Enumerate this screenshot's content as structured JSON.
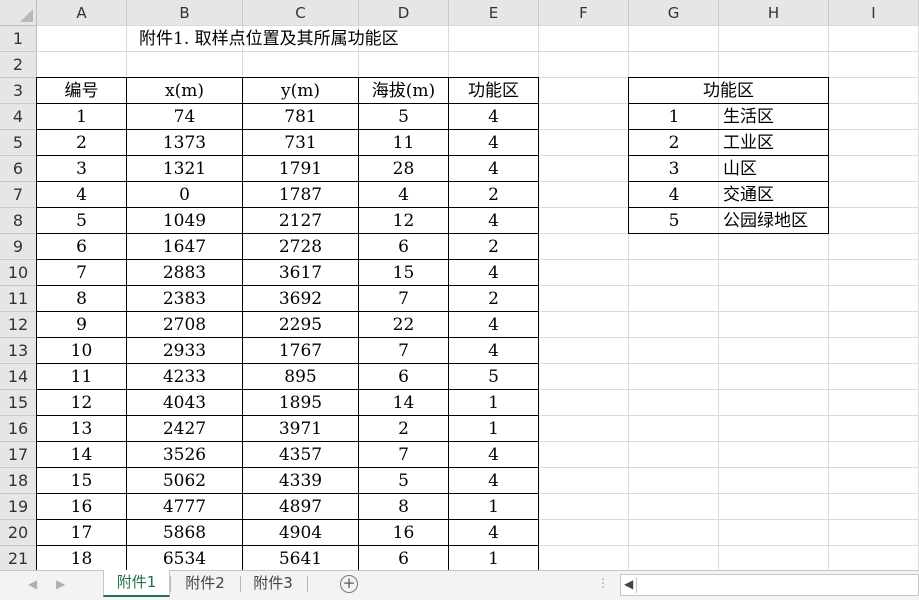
{
  "column_headers": [
    "A",
    "B",
    "C",
    "D",
    "E",
    "F",
    "G",
    "H",
    "I"
  ],
  "row_headers": [
    "1",
    "2",
    "3",
    "4",
    "5",
    "6",
    "7",
    "8",
    "9",
    "10",
    "11",
    "12",
    "13",
    "14",
    "15",
    "16",
    "17",
    "18",
    "19",
    "20",
    "21"
  ],
  "title": "附件1. 取样点位置及其所属功能区",
  "table_headers": [
    "编号",
    "x(m)",
    "y(m)",
    "海拔(m)",
    "功能区"
  ],
  "table_rows": [
    [
      "1",
      "74",
      "781",
      "5",
      "4"
    ],
    [
      "2",
      "1373",
      "731",
      "11",
      "4"
    ],
    [
      "3",
      "1321",
      "1791",
      "28",
      "4"
    ],
    [
      "4",
      "0",
      "1787",
      "4",
      "2"
    ],
    [
      "5",
      "1049",
      "2127",
      "12",
      "4"
    ],
    [
      "6",
      "1647",
      "2728",
      "6",
      "2"
    ],
    [
      "7",
      "2883",
      "3617",
      "15",
      "4"
    ],
    [
      "8",
      "2383",
      "3692",
      "7",
      "2"
    ],
    [
      "9",
      "2708",
      "2295",
      "22",
      "4"
    ],
    [
      "10",
      "2933",
      "1767",
      "7",
      "4"
    ],
    [
      "11",
      "4233",
      "895",
      "6",
      "5"
    ],
    [
      "12",
      "4043",
      "1895",
      "14",
      "1"
    ],
    [
      "13",
      "2427",
      "3971",
      "2",
      "1"
    ],
    [
      "14",
      "3526",
      "4357",
      "7",
      "4"
    ],
    [
      "15",
      "5062",
      "4339",
      "5",
      "4"
    ],
    [
      "16",
      "4777",
      "4897",
      "8",
      "1"
    ],
    [
      "17",
      "5868",
      "4904",
      "16",
      "4"
    ],
    [
      "18",
      "6534",
      "5641",
      "6",
      "1"
    ]
  ],
  "legend": {
    "header": "功能区",
    "rows": [
      [
        "1",
        "生活区"
      ],
      [
        "2",
        "工业区"
      ],
      [
        "3",
        "山区"
      ],
      [
        "4",
        "交通区"
      ],
      [
        "5",
        "公园绿地区"
      ]
    ]
  },
  "sheet_tabs": [
    "附件1",
    "附件2",
    "附件3"
  ],
  "active_tab": "附件1",
  "add_sheet_symbol": "+",
  "nav_prev_symbol": "◀",
  "nav_next_symbol": "▶",
  "splitter_symbol": "⋮",
  "hscroll_left_symbol": "◀",
  "colors": {
    "header_bg": "#e6e6e6",
    "gridline": "#dadada",
    "active_tab": "#217346"
  }
}
